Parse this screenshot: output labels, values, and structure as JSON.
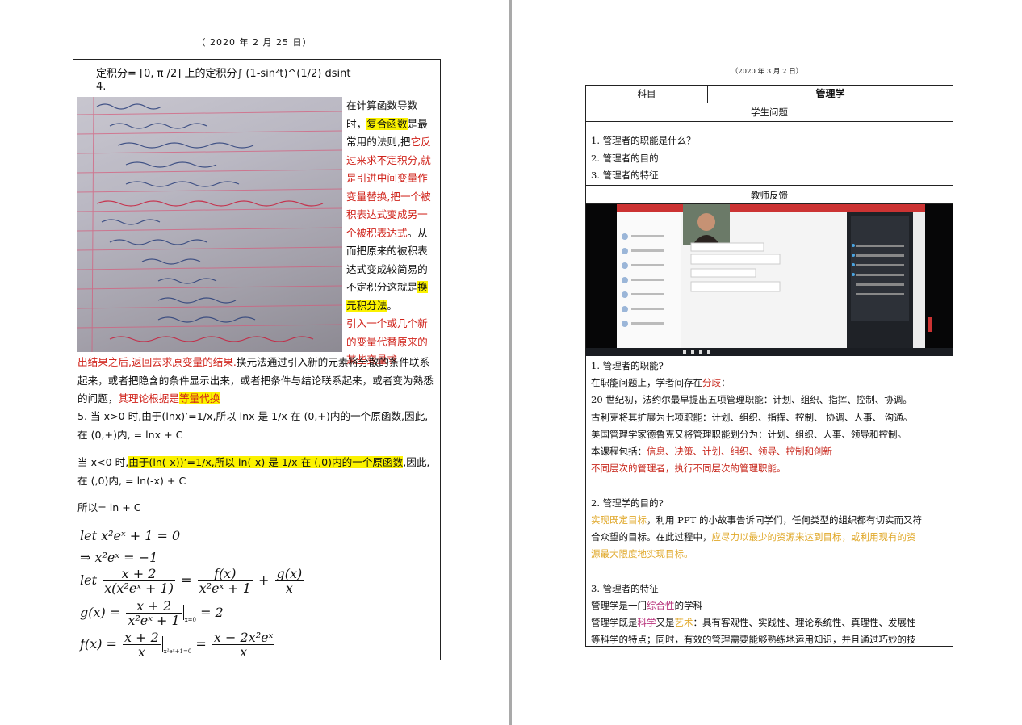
{
  "left": {
    "date": "（ 2020 年 2 月 25 日）",
    "line1": "定积分= [0, π /2] 上的定积分∫ (1-sin²t)^(1/2) dsint",
    "line2": "4.",
    "photo_alt": "handwritten-notes-photo",
    "side_p1": "在计算函数导数时，",
    "side_p2_hl": "复合函数",
    "side_p3": "是最常用的法则,把",
    "side_p4_red": "它反过来求不定积分,就是引进中间变量作变量替换,把一个被积表达式变成另一个被积表达式",
    "side_p5": "。从而把原来的被积表达式变成较简易的不定积分这就是",
    "side_p6_hl": "换元积分法",
    "side_p7": "。",
    "side_p8_red": "引入一个或几个新的变量代替原来的某些变量求",
    "para_red": "出结果之后,返回去求原变量的结果.",
    "para_text": "换元法通过引入新的元素将分散的条件联系起来，或者把隐含的条件显示出来，或者把条件与结论联系起来，或者变为熟悉的问题，",
    "para_red2": "其理论根据是",
    "para_hl": "等量代换",
    "item5": "5.  当 x>0 时,由于(lnx)’=1/x,所以 lnx 是 1/x 在 (0,+)内的一个原函数,因此,在 (0,+)内, = lnx + C",
    "item5b_pre": "当 x<0 时,",
    "item5b_hl": "由于(ln(-x))’=1/x,所以 ln(-x) 是 1/x 在 (,0)内的一个原函数",
    "item5b_post": ",因此,在 (,0)内, = ln(-x) + C",
    "item5c": "所以= ln + C",
    "math": {
      "l1": "let x²eˣ + 1 = 0",
      "l2": "⇒ x²eˣ = −1",
      "l3_let": "let",
      "l3_n1": "x + 2",
      "l3_d1": "x(x²eˣ + 1)",
      "l3_eq": "=",
      "l3_n2": "f(x)",
      "l3_d2": "x²eˣ + 1",
      "l3_plus": "+",
      "l3_n3": "g(x)",
      "l3_d3": "x",
      "l4_g": "g(x) =",
      "l4_n": "x + 2",
      "l4_d": "x²eˣ + 1",
      "l4_sub": "x=0",
      "l4_eq": "= 2",
      "l5_f": "f(x) =",
      "l5_n": "x + 2",
      "l5_d": "x",
      "l5_sub": "x²eˣ+1=0",
      "l5_eq": "=",
      "l5_n2": "x − 2x²eˣ",
      "l5_d2": "x"
    }
  },
  "right": {
    "date": "（2020 年 3 月 2 日）",
    "subject_label": "科目",
    "subject_value": "管理学",
    "student_q_header": "学生问题",
    "questions": [
      "1. 管理者的职能是什么？",
      "2. 管理者的目的",
      "3. 管理者的特征"
    ],
    "teacher_fb_header": "教师反馈",
    "fb": {
      "l1": "1. 管理者的职能?",
      "l2_pre": "在职能问题上，学者间存在",
      "l2_red": "分歧",
      "l2_post": "：",
      "l3": "20 世纪初，法约尔最早提出五项管理职能：计划、组织、指挥、控制、协调。",
      "l4": "古利克将其扩展为七项职能：计划、组织、指挥、控制、 协调、人事、 沟通。",
      "l5": "美国管理学家德鲁克又将管理职能划分为：计划、组织、人事、领导和控制。",
      "l6_pre": "本课程包括：",
      "l6_red": "信息、决策、计划、组织、领导、控制和创新",
      "l7_red": "不同层次的管理者，执行不同层次的管理职能。",
      "l8": "2. 管理学的目的?",
      "l9_gold": "实现既定目标",
      "l9_post": "，利用 PPT 的小故事告诉同学们，任何类型的组织都有切实而又符",
      "l10_pre": "合众望的目标。在此过程中，",
      "l10_gold": "应尽力以最少的资源来达到目标，或利用现有的资",
      "l11_gold": "源最大限度地实现目标。",
      "l12": "3. 管理者的特征",
      "l13_pre": "管理学是一门",
      "l13_pink": "综合性",
      "l13_post": "的学科",
      "l14_pre": "管理学既是",
      "l14_pink": "科学",
      "l14_mid": "又是",
      "l14_gold": "艺术",
      "l14_post": "：具有客观性、实践性、理论系统性、真理性、发展性",
      "l15": "等科学的特点；同时，有效的管理需要能够熟练地运用知识，并且通过巧妙的技"
    }
  }
}
